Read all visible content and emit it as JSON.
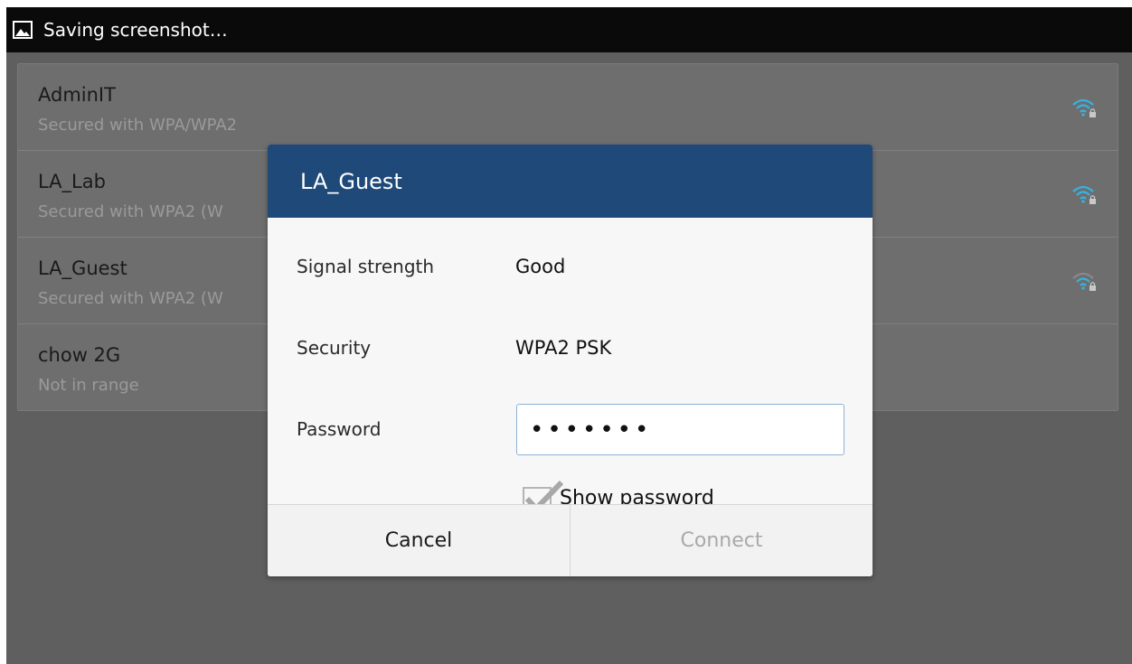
{
  "statusbar": {
    "icon": "image-icon",
    "text": "Saving screenshot…"
  },
  "networks": [
    {
      "name": "AdminIT",
      "status": "Secured with WPA/WPA2",
      "icon": "wifi-lock-icon"
    },
    {
      "name": "LA_Lab",
      "status": "Secured with WPA2 (W",
      "icon": "wifi-lock-icon"
    },
    {
      "name": "LA_Guest",
      "status": "Secured with WPA2 (W",
      "icon": "wifi-lock-icon"
    },
    {
      "name": "chow 2G",
      "status": "Not in range"
    }
  ],
  "dialog": {
    "title": "LA_Guest",
    "signal_label": "Signal strength",
    "signal_value": "Good",
    "security_label": "Security",
    "security_value": "WPA2 PSK",
    "password_label": "Password",
    "password_value": "•••••••",
    "show_password_label": "Show password",
    "show_password_checked": true,
    "cancel_label": "Cancel",
    "connect_label": "Connect"
  },
  "colors": {
    "header": "#1f4979",
    "background": "#5f5f5f",
    "input_border": "#8fb2d6",
    "disabled_text": "#a9a9a9"
  }
}
